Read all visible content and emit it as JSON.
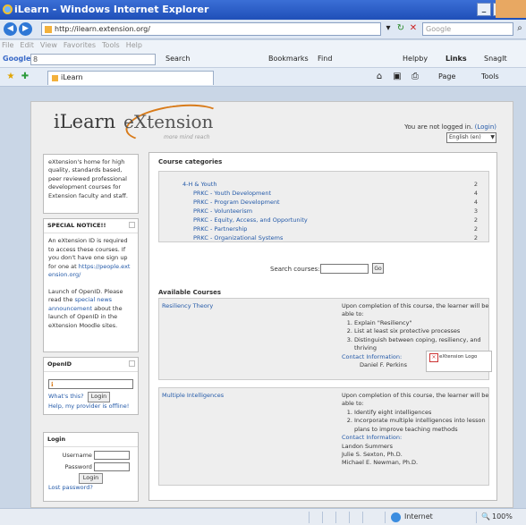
{
  "window": {
    "title": "iLearn - Windows Internet Explorer",
    "controls": [
      "_",
      "□",
      "×"
    ]
  },
  "address": {
    "url": "http://ilearn.extension.org/",
    "search_placeholder": "Google"
  },
  "menu": [
    "File",
    "Edit",
    "View",
    "Favorites",
    "Tools",
    "Help"
  ],
  "toolbar": {
    "google_label": "Google",
    "search": "Search",
    "bookmarks": "Bookmarks",
    "find": "Find",
    "helpby": "Helpby",
    "links": "Links",
    "snagit": "SnagIt"
  },
  "tab": {
    "label": "iLearn",
    "page_menu": "Page",
    "tools_menu": "Tools"
  },
  "site": {
    "logo_text": "iLearn",
    "partner_logo": "eXtension",
    "tagline": "more mind reach",
    "login_status": "You are not logged in.",
    "login_link": "(Login)",
    "language": "English (en)"
  },
  "left": {
    "intro": "eXtension's home for high quality, standards based, peer reviewed professional development courses for Extension faculty and staff.",
    "notice_title": "SPECIAL NOTICE!!",
    "notice_text1": "An eXtension ID is required to access these courses. If you don't have one sign up for one at",
    "notice_link1": "https://people.extension.org/",
    "notice_text2": "Launch of OpenID. Please read the",
    "notice_link2": "special news announcement",
    "notice_text3": "about the launch of OpenID in the eXtension Moodle sites.",
    "openid_title": "OpenID",
    "openid_whats": "What's this?",
    "openid_login": "Login",
    "openid_help": "Help, my provider is offline!",
    "login_title": "Login",
    "username_label": "Username",
    "password_label": "Password",
    "login_button": "Login",
    "lost_password": "Lost password?"
  },
  "categories": {
    "title": "Course categories",
    "rows": [
      {
        "name": "4-H & Youth",
        "count": "2"
      },
      {
        "name": "PRKC - Youth Development",
        "count": "4"
      },
      {
        "name": "PRKC - Program Development",
        "count": "4"
      },
      {
        "name": "PRKC - Volunteerism",
        "count": "3"
      },
      {
        "name": "PRKC - Equity, Access, and Opportunity",
        "count": "2"
      },
      {
        "name": "PRKC - Partnership",
        "count": "2"
      },
      {
        "name": "PRKC - Organizational Systems",
        "count": "2"
      }
    ]
  },
  "search": {
    "label": "Search courses:",
    "button": "Go"
  },
  "courses": {
    "title": "Available Courses",
    "items": [
      {
        "name": "Resiliency Theory",
        "intro": "Upon completion of this course, the learner will be able to:",
        "points": [
          "Explain \"Resiliency\"",
          "List at least six protective processes",
          "Distinguish between coping, resiliency, and thriving"
        ],
        "contact_label": "Contact Information:",
        "contacts": [
          "Daniel F. Perkins"
        ],
        "image_alt": "eXtension Logo"
      },
      {
        "name": "Multiple Intelligences",
        "intro": "Upon completion of this course, the learner will be able to:",
        "points": [
          "Identify eight intelligences",
          "Incorporate multiple intelligences into lesson plans to improve teaching methods"
        ],
        "contact_label": "Contact Information:",
        "contacts": [
          "Landon Summers",
          "Julie S. Sexton, Ph.D.",
          "Michael E. Newman, Ph.D."
        ]
      }
    ]
  },
  "status": {
    "zone": "Internet",
    "zoom": "100%"
  }
}
